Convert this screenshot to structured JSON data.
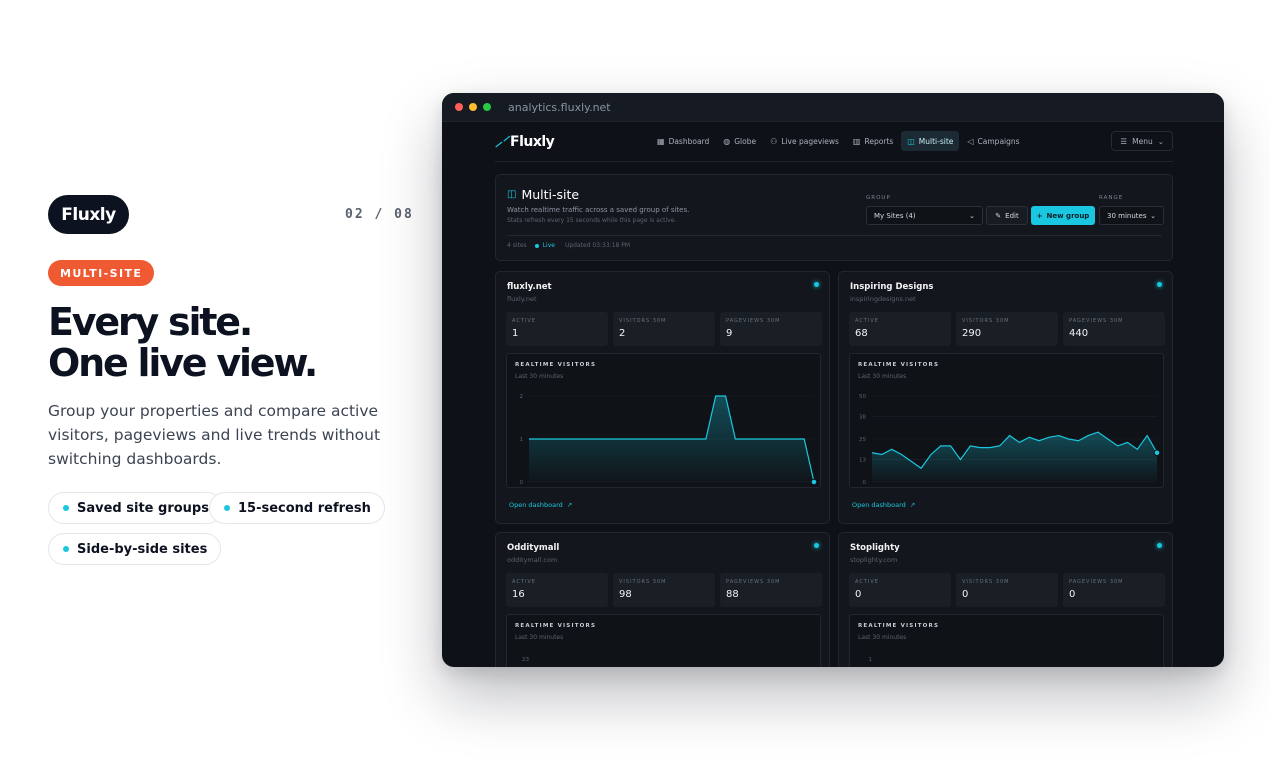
{
  "brand": {
    "name": "Fluxly"
  },
  "counter": "02 / 08",
  "tag": "MULTI-SITE",
  "headline": {
    "line1": "Every site.",
    "line2": "One live view."
  },
  "subtext": "Group your properties and compare active visitors, pageviews and live trends without switching dashboards.",
  "chips": [
    "Saved site groups",
    "15-second refresh",
    "Side-by-side sites"
  ],
  "colors": {
    "accent": "#19c8e0",
    "tag": "#f05a33",
    "window_bg": "#0e1117",
    "card_bg": "#13161c"
  },
  "browser": {
    "url": "analytics.fluxly.net"
  },
  "app": {
    "logo": "Fluxly",
    "nav": [
      {
        "label": "Dashboard",
        "icon": "grid-icon"
      },
      {
        "label": "Globe",
        "icon": "globe-icon"
      },
      {
        "label": "Live pageviews",
        "icon": "users-icon"
      },
      {
        "label": "Reports",
        "icon": "bar-chart-icon"
      },
      {
        "label": "Multi-site",
        "icon": "layout-icon",
        "active": true
      },
      {
        "label": "Campaigns",
        "icon": "megaphone-icon"
      }
    ],
    "menu_label": "Menu",
    "header": {
      "title": "Multi-site",
      "description": "Watch realtime traffic across a saved group of sites.",
      "note": "Stats refresh every 15 seconds while this page is active.",
      "sites_count": "4 sites",
      "live_label": "Live",
      "updated": "Updated 03:33:18 PM",
      "group_label": "GROUP",
      "group_value": "My Sites (4)",
      "edit_label": "Edit",
      "new_group_label": "New group",
      "range_label": "RANGE",
      "range_value": "30 minutes"
    },
    "sites": [
      {
        "name": "fluxly.net",
        "host": "fluxly.net",
        "stats": [
          {
            "label": "ACTIVE",
            "value": "1"
          },
          {
            "label": "VISITORS 30M",
            "value": "2"
          },
          {
            "label": "PAGEVIEWS 30M",
            "value": "9"
          }
        ],
        "chart_title": "REALTIME VISITORS",
        "chart_sub": "Last 30 minutes",
        "open_label": "Open dashboard"
      },
      {
        "name": "Inspiring Designs",
        "host": "inspiringdesigns.net",
        "stats": [
          {
            "label": "ACTIVE",
            "value": "68"
          },
          {
            "label": "VISITORS 30M",
            "value": "290"
          },
          {
            "label": "PAGEVIEWS 30M",
            "value": "440"
          }
        ],
        "chart_title": "REALTIME VISITORS",
        "chart_sub": "Last 30 minutes",
        "open_label": "Open dashboard"
      },
      {
        "name": "Odditymall",
        "host": "odditymall.com",
        "stats": [
          {
            "label": "ACTIVE",
            "value": "16"
          },
          {
            "label": "VISITORS 30M",
            "value": "98"
          },
          {
            "label": "PAGEVIEWS 30M",
            "value": "88"
          }
        ],
        "chart_title": "REALTIME VISITORS",
        "chart_sub": "Last 30 minutes",
        "open_label": "Open dashboard"
      },
      {
        "name": "Stoplighty",
        "host": "stoplighty.com",
        "stats": [
          {
            "label": "ACTIVE",
            "value": "0"
          },
          {
            "label": "VISITORS 30M",
            "value": "0"
          },
          {
            "label": "PAGEVIEWS 30M",
            "value": "0"
          }
        ],
        "chart_title": "REALTIME VISITORS",
        "chart_sub": "Last 30 minutes",
        "open_label": "Open dashboard"
      }
    ]
  },
  "chart_data": [
    {
      "type": "line",
      "title": "REALTIME VISITORS",
      "subtitle": "Last 30 minutes",
      "ylim": [
        0,
        2
      ],
      "yticks": [
        "0",
        "1",
        "2"
      ],
      "x": [
        1,
        2,
        3,
        4,
        5,
        6,
        7,
        8,
        9,
        10,
        11,
        12,
        13,
        14,
        15,
        16,
        17,
        18,
        19,
        20,
        21,
        22,
        23,
        24,
        25,
        26,
        27,
        28,
        29,
        30
      ],
      "series": [
        {
          "values": [
            1,
            1,
            1,
            1,
            1,
            1,
            1,
            1,
            1,
            1,
            1,
            1,
            1,
            1,
            1,
            1,
            1,
            1,
            1,
            2,
            2,
            1,
            1,
            1,
            1,
            1,
            1,
            1,
            1,
            0
          ]
        }
      ]
    },
    {
      "type": "line",
      "title": "REALTIME VISITORS",
      "subtitle": "Last 30 minutes",
      "ylim": [
        0,
        50
      ],
      "yticks": [
        "0",
        "13",
        "25",
        "38",
        "50"
      ],
      "x": [
        1,
        2,
        3,
        4,
        5,
        6,
        7,
        8,
        9,
        10,
        11,
        12,
        13,
        14,
        15,
        16,
        17,
        18,
        19,
        20,
        21,
        22,
        23,
        24,
        25,
        26,
        27,
        28,
        29,
        30
      ],
      "series": [
        {
          "values": [
            17,
            16,
            19,
            16,
            12,
            8,
            16,
            21,
            21,
            13,
            21,
            20,
            20,
            21,
            27,
            23,
            26,
            24,
            26,
            27,
            25,
            24,
            27,
            29,
            25,
            21,
            23,
            19,
            27,
            17
          ]
        }
      ]
    },
    {
      "type": "line",
      "title": "REALTIME VISITORS",
      "subtitle": "Last 30 minutes",
      "yticks": [
        "23"
      ],
      "series": []
    },
    {
      "type": "line",
      "title": "REALTIME VISITORS",
      "subtitle": "Last 30 minutes",
      "yticks": [
        "1"
      ],
      "series": []
    }
  ]
}
